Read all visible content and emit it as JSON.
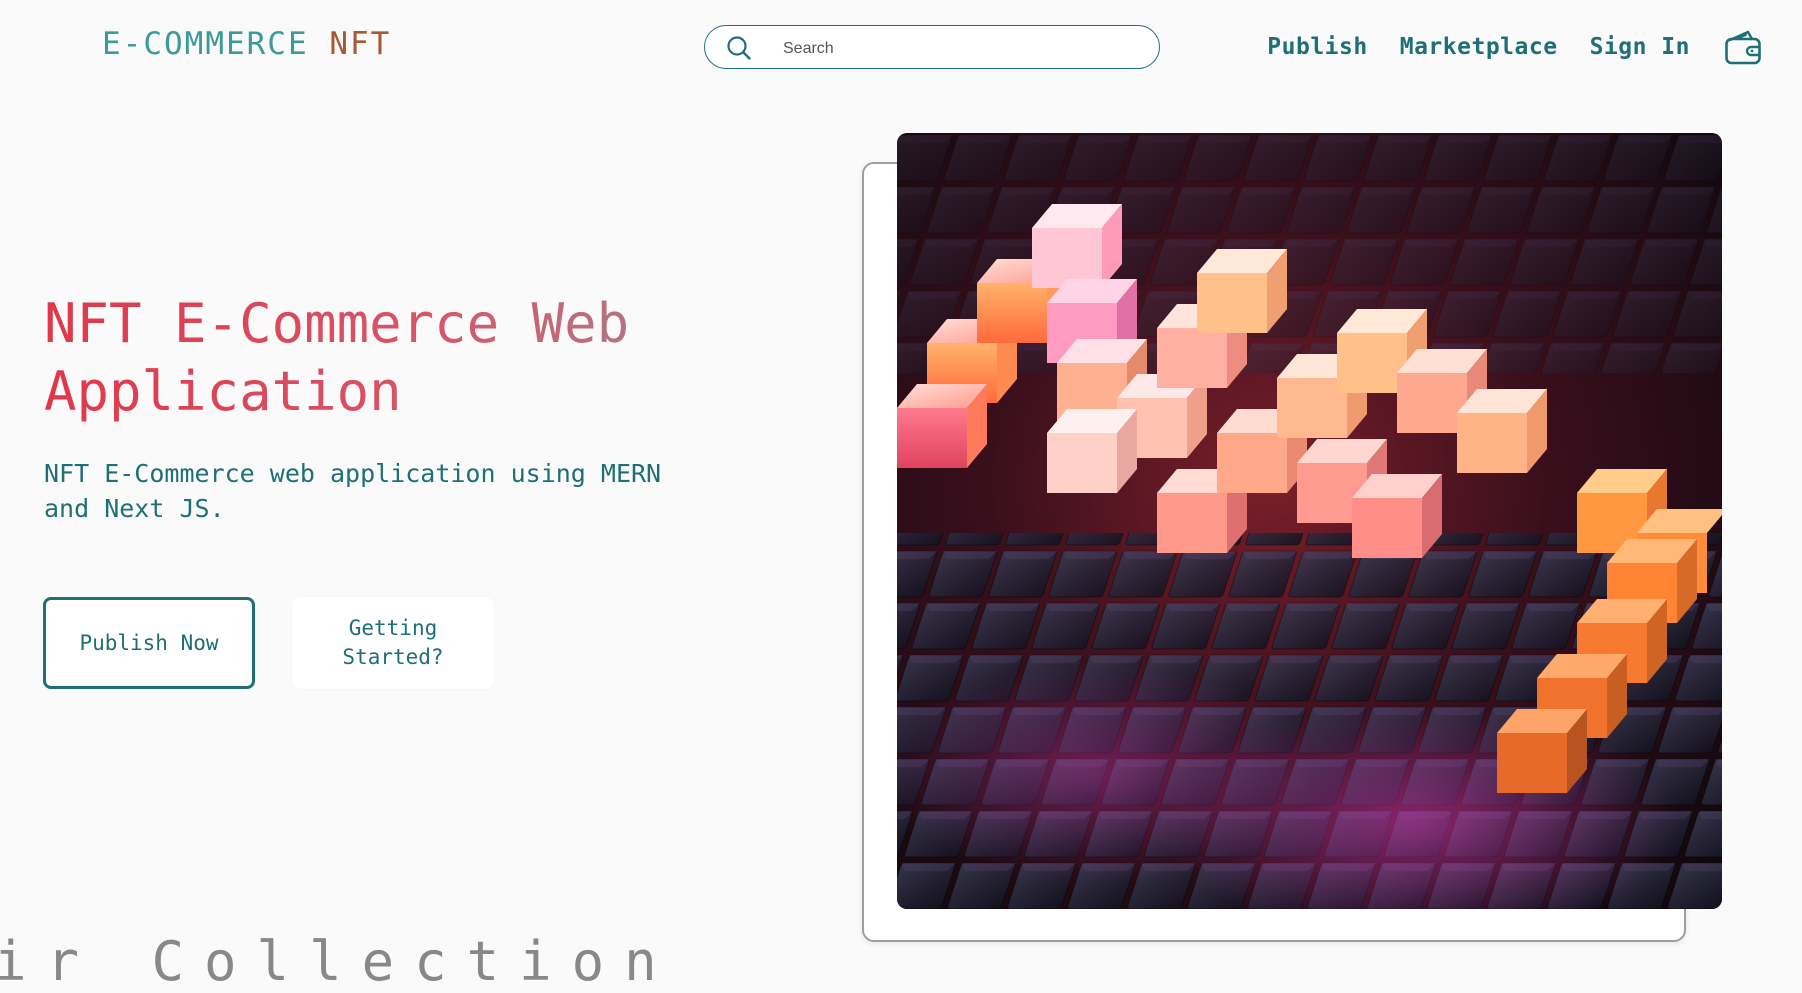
{
  "brand": {
    "part1": "E-COMMERCE",
    "part2": "NFT"
  },
  "search": {
    "placeholder": "Search",
    "value": ""
  },
  "nav": {
    "publish": "Publish",
    "marketplace": "Marketplace",
    "signin": "Sign In"
  },
  "icons": {
    "search": "search-icon",
    "wallet": "wallet-icon"
  },
  "hero": {
    "title": "NFT E-Commerce Web Application",
    "subtitle": "NFT E-Commerce web application using MERN and Next JS.",
    "publish_button": "Publish Now",
    "start_button": "Getting Started?",
    "image_alt": "glowing 3D cube artwork"
  },
  "next_section": {
    "heading_peek": "ir Collection"
  },
  "colors": {
    "primary": "#1f6f76",
    "logo_teal": "#3c9a98",
    "logo_brown": "#a55a32",
    "title_red": "#e0374a",
    "title_grey": "#9a8894",
    "background": "#fafafa"
  }
}
